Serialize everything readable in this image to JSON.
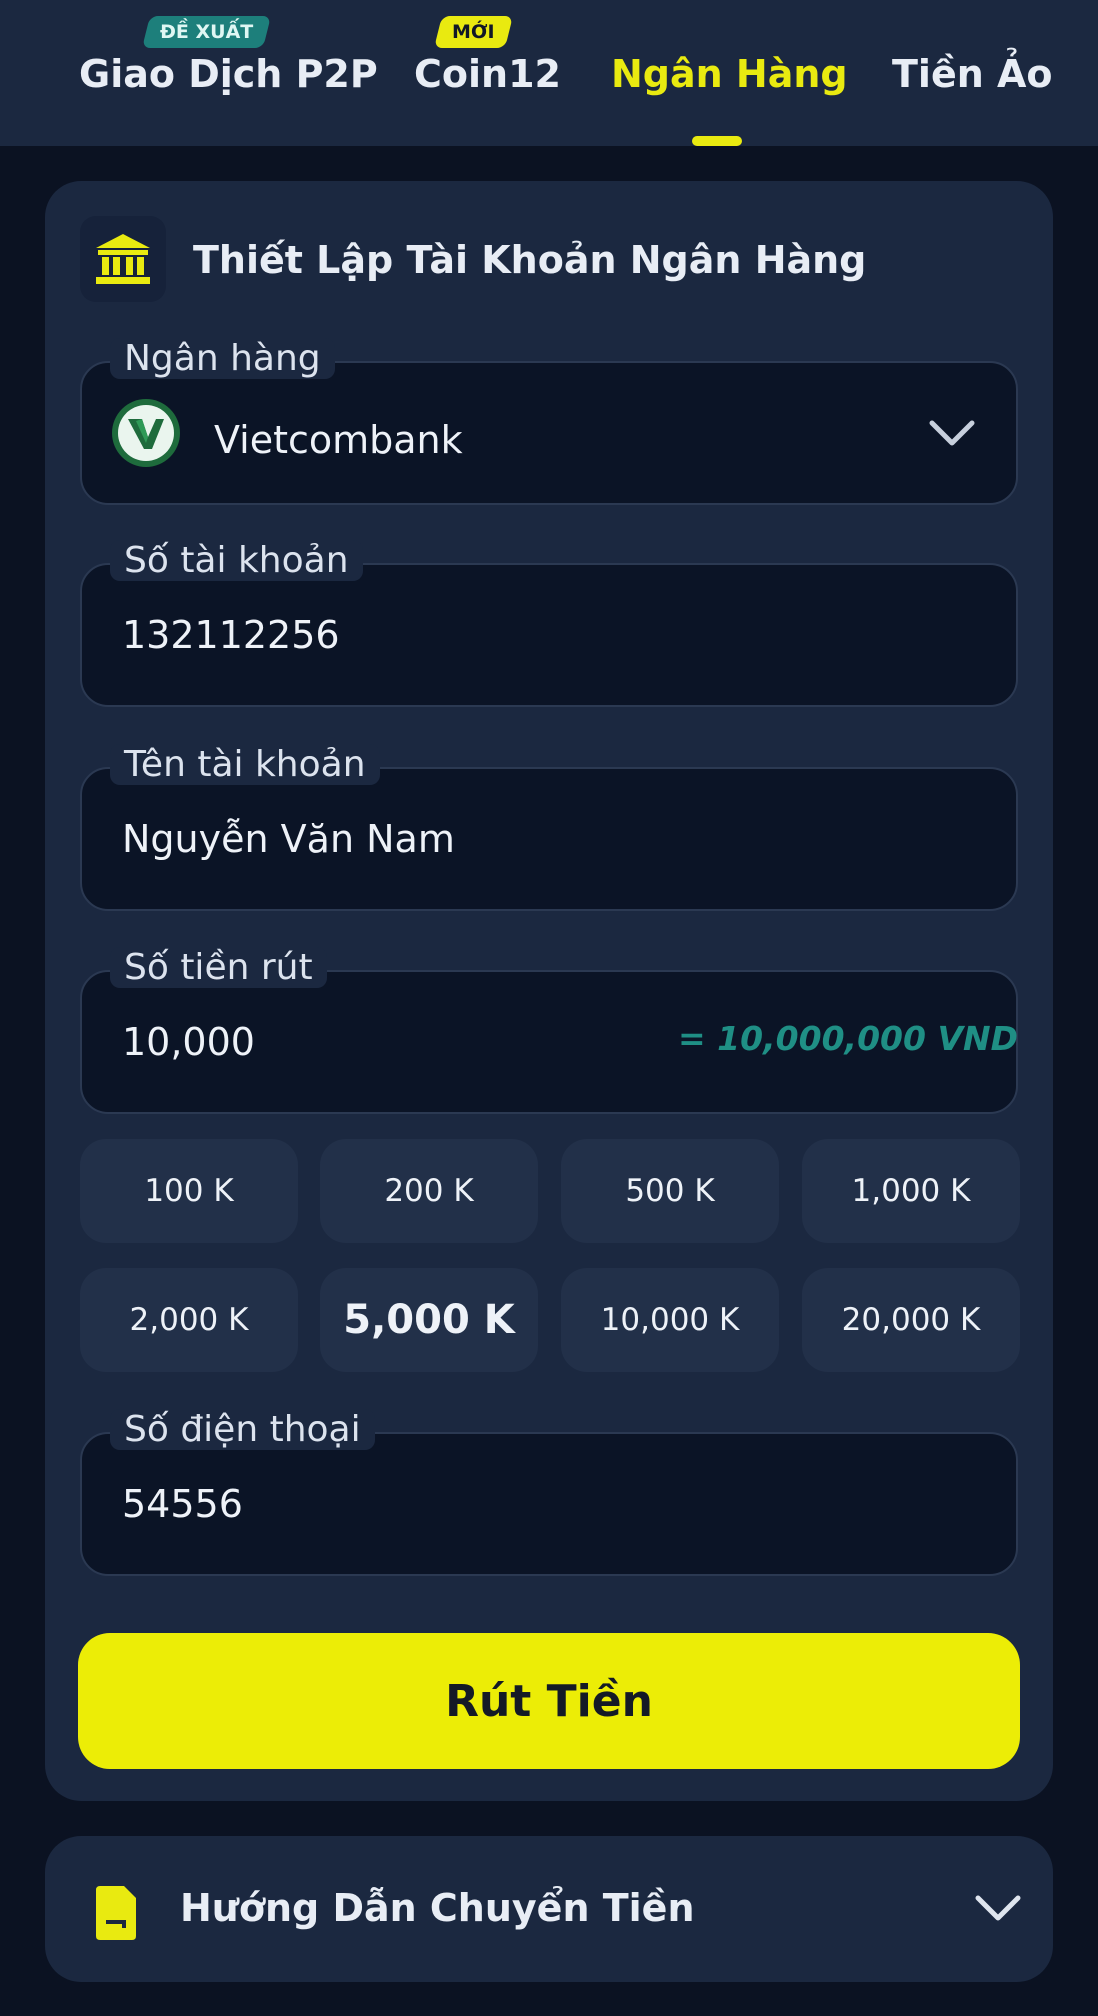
{
  "tabs": [
    {
      "label": "Giao Dịch P2P",
      "badge": "ĐỀ XUẤT"
    },
    {
      "label": "Coin12",
      "badge": "MỚI"
    },
    {
      "label": "Ngân Hàng",
      "active": true
    },
    {
      "label": "Tiền Ảo"
    }
  ],
  "card": {
    "title": "Thiết Lập Tài Khoản Ngân Hàng",
    "icon": "bank-icon"
  },
  "form": {
    "bank": {
      "label": "Ngân hàng",
      "value": "Vietcombank",
      "logo": "vietcombank-logo"
    },
    "account_number": {
      "label": "Số tài khoản",
      "value": "132112256"
    },
    "account_name": {
      "label": "Tên tài khoản",
      "value": "Nguyễn Văn Nam"
    },
    "amount": {
      "label": "Số tiền rút",
      "value": "10,000",
      "conversion": "= 10,000,000 VND"
    },
    "quick_amounts": [
      "100 K",
      "200 K",
      "500 K",
      "1,000 K",
      "2,000 K",
      "5,000 K",
      "10,000 K",
      "20,000 K"
    ],
    "selected_quick_amount": "5,000 K",
    "phone": {
      "label": "Số điện thoại",
      "value": "54556"
    }
  },
  "withdraw_button": "Rút Tiền",
  "guide": {
    "title": "Hướng Dẫn Chuyển Tiền",
    "icon": "sim-card-icon"
  },
  "colors": {
    "accent": "#e9ea10",
    "background": "#0b1222",
    "card": "#1b2840",
    "conversion": "#1f8f85",
    "badge_recommend": "#1d7f7b"
  }
}
